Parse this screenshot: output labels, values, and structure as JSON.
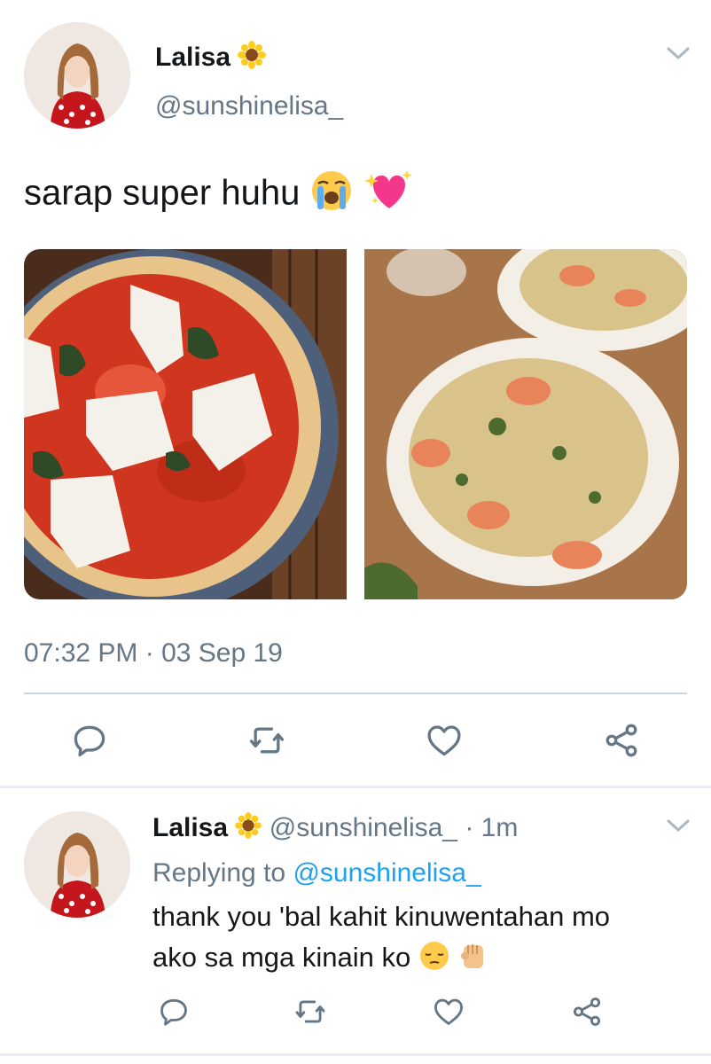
{
  "tweet": {
    "author_name": "Lalisa",
    "author_handle": "@sunshinelisa_",
    "text": "sarap super huhu",
    "text_emojis": [
      "loudly-crying-face",
      "sparkling-heart"
    ],
    "name_emoji": "sunflower",
    "timestamp": "07:32 PM · 03 Sep 19",
    "media": [
      {
        "icon": "pizza-photo"
      },
      {
        "icon": "shrimp-pasta-photo"
      }
    ]
  },
  "reply": {
    "author_name": "Lalisa",
    "author_handle": "@sunshinelisa_",
    "separator": " · ",
    "time": "1m",
    "replying_prefix": "Replying to ",
    "replying_to": "@sunshinelisa_",
    "text_line1": "thank you 'bal kahit kinuwentahan mo",
    "text_line2": "ako sa mga kinain ko",
    "text_emojis": [
      "pensive-face",
      "raised-fist"
    ]
  },
  "actions": [
    "reply-icon",
    "retweet-icon",
    "like-icon",
    "share-icon"
  ],
  "colors": {
    "text": "#14171a",
    "secondary": "#657786",
    "link": "#1da1f2",
    "divider": "#ccd6dd"
  }
}
